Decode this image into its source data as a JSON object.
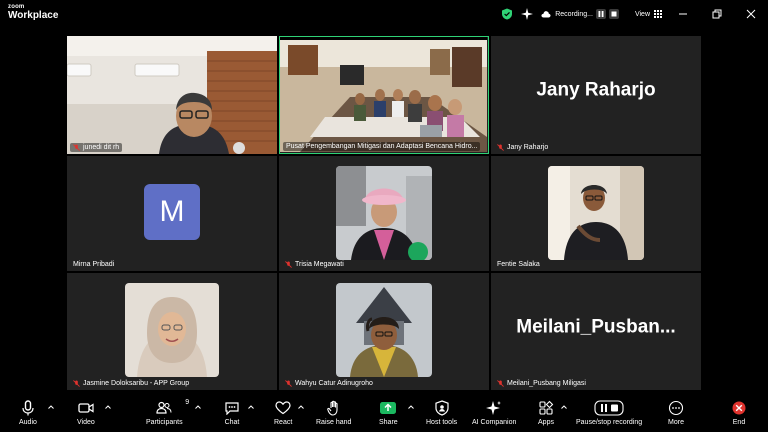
{
  "app": {
    "logo_top": "zoom",
    "logo_bottom": "Workplace"
  },
  "header": {
    "recording_label": "Recording...",
    "view_label": "View"
  },
  "tiles": {
    "t1_name": "junedi dit rh",
    "t2_name": "Pusat Pengembangan Mitigasi dan Adaptasi Bencana Hidro...",
    "t3_display": "Jany Raharjo",
    "t3_name": "Jany Raharjo",
    "t4_initial": "M",
    "t4_name": "Mirna Pribadi",
    "t5_name": "Trisia Megawati",
    "t6_name": "Fentie Salaka",
    "t7_name": "Jasmine Doloksaribu - APP Group",
    "t8_name": "Wahyu Catur Adinugroho",
    "t9_display": "Meilani_Pusban...",
    "t9_name": "Meilani_Pusbang Miligasi"
  },
  "toolbar": {
    "audio": "Audio",
    "video": "Video",
    "participants": "Participants",
    "participants_count": "9",
    "chat": "Chat",
    "react": "React",
    "raise_hand": "Raise hand",
    "share": "Share",
    "host_tools": "Host tools",
    "ai_companion": "AI Companion",
    "apps": "Apps",
    "pause_stop": "Pause/stop recording",
    "more": "More",
    "end": "End"
  },
  "colors": {
    "accent_green": "#2fd276",
    "share_green": "#1bb860",
    "end_red": "#e0332e",
    "avatar_purple": "#5f6fc6",
    "tile_bg": "#222222"
  }
}
